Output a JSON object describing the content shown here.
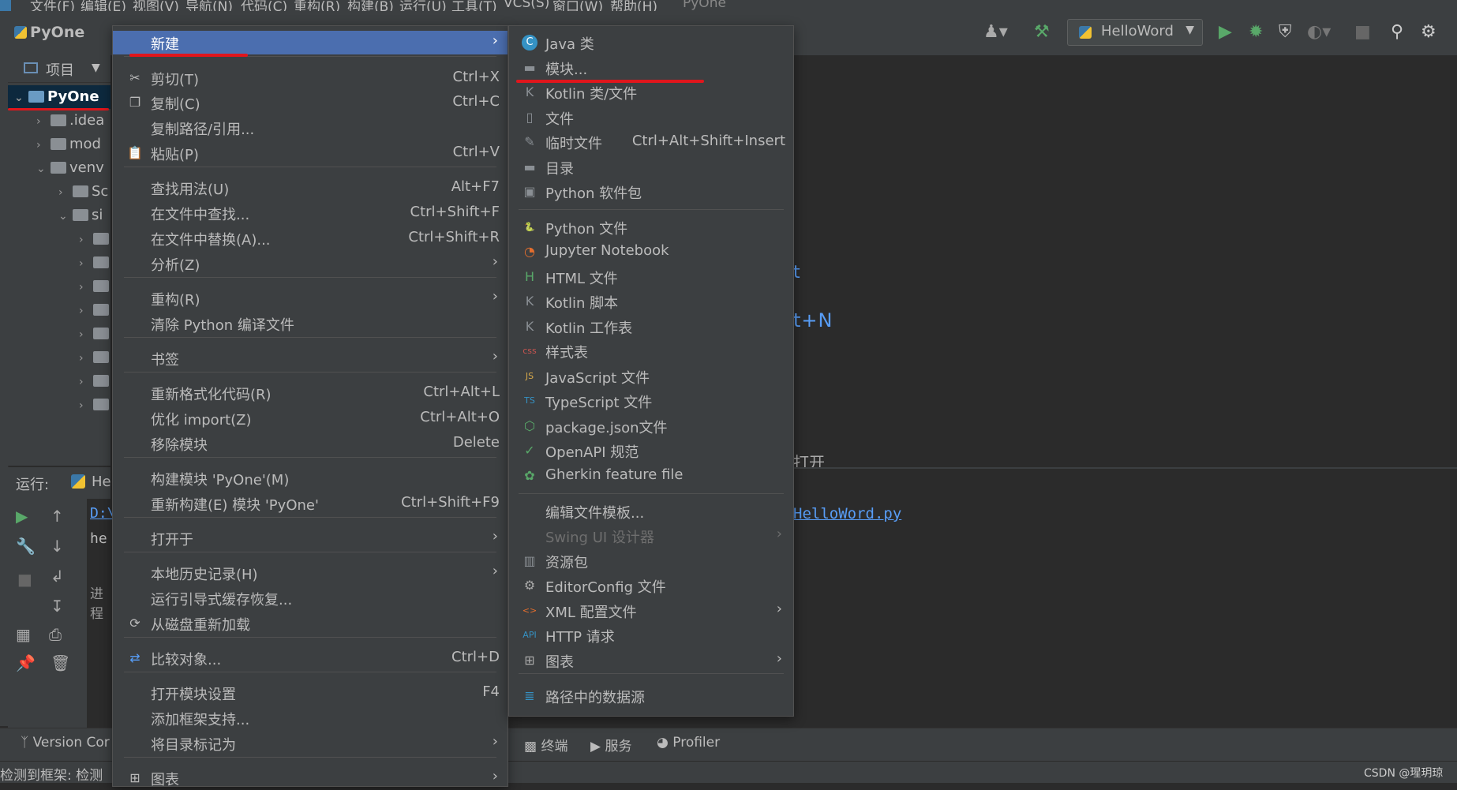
{
  "menubar": {
    "items": [
      "文件(F)",
      "编辑(E)",
      "视图(V)",
      "导航(N)",
      "代码(C)",
      "重构(R)",
      "构建(B)",
      "运行(U)",
      "工具(T)",
      "VCS(S)",
      "窗口(W)",
      "帮助(H)"
    ],
    "app_title": "PyOne"
  },
  "toolbar": {
    "project_name": "PyOne",
    "run_config": "HelloWord"
  },
  "project_panel": {
    "header": "项目",
    "root": "PyOne",
    "nodes": [
      ".idea",
      "mod",
      "venv",
      "Sc",
      "si"
    ]
  },
  "run_panel": {
    "header_label": "运行:",
    "tab": "He",
    "line1": "D:\\",
    "line2": "he",
    "line3": "进程",
    "path_tail": "HelloWord.py"
  },
  "editor": {
    "hint1": "t",
    "hint2": "t+N",
    "hint3": "打开"
  },
  "context_menu": {
    "items": [
      {
        "label": "新建",
        "shortcut": "",
        "submenu": true,
        "icon": ""
      },
      {
        "label": "剪切(T)",
        "shortcut": "Ctrl+X",
        "icon": "scissors-icon"
      },
      {
        "label": "复制(C)",
        "shortcut": "Ctrl+C",
        "icon": "copy-icon"
      },
      {
        "label": "复制路径/引用...",
        "shortcut": ""
      },
      {
        "label": "粘贴(P)",
        "shortcut": "Ctrl+V",
        "icon": "paste-icon"
      },
      {
        "label": "查找用法(U)",
        "shortcut": "Alt+F7"
      },
      {
        "label": "在文件中查找...",
        "shortcut": "Ctrl+Shift+F"
      },
      {
        "label": "在文件中替换(A)...",
        "shortcut": "Ctrl+Shift+R"
      },
      {
        "label": "分析(Z)",
        "shortcut": "",
        "submenu": true
      },
      {
        "label": "重构(R)",
        "shortcut": "",
        "submenu": true
      },
      {
        "label": "清除 Python 编译文件",
        "shortcut": ""
      },
      {
        "label": "书签",
        "shortcut": "",
        "submenu": true
      },
      {
        "label": "重新格式化代码(R)",
        "shortcut": "Ctrl+Alt+L"
      },
      {
        "label": "优化 import(Z)",
        "shortcut": "Ctrl+Alt+O"
      },
      {
        "label": "移除模块",
        "shortcut": "Delete"
      },
      {
        "label": "构建模块 'PyOne'(M)",
        "shortcut": ""
      },
      {
        "label": "重新构建(E) 模块 'PyOne'",
        "shortcut": "Ctrl+Shift+F9"
      },
      {
        "label": "打开于",
        "shortcut": "",
        "submenu": true
      },
      {
        "label": "本地历史记录(H)",
        "shortcut": "",
        "submenu": true
      },
      {
        "label": "运行引导式缓存恢复...",
        "shortcut": ""
      },
      {
        "label": "从磁盘重新加载",
        "shortcut": "",
        "icon": "reload-icon"
      },
      {
        "label": "比较对象...",
        "shortcut": "Ctrl+D",
        "icon": "compare-icon"
      },
      {
        "label": "打开模块设置",
        "shortcut": "F4"
      },
      {
        "label": "添加框架支持...",
        "shortcut": ""
      },
      {
        "label": "将目录标记为",
        "shortcut": "",
        "submenu": true
      },
      {
        "label": "图表",
        "shortcut": "",
        "submenu": true,
        "icon": "diagram-icon"
      }
    ]
  },
  "new_submenu": {
    "items": [
      {
        "label": "Java 类",
        "shortcut": "",
        "icon": "java-class-icon"
      },
      {
        "label": "模块...",
        "shortcut": "",
        "icon": "module-icon"
      },
      {
        "label": "Kotlin 类/文件",
        "shortcut": "",
        "icon": "kotlin-file-icon"
      },
      {
        "label": "文件",
        "shortcut": "",
        "icon": "file-icon"
      },
      {
        "label": "临时文件",
        "shortcut": "Ctrl+Alt+Shift+Insert",
        "icon": "scratch-file-icon"
      },
      {
        "label": "目录",
        "shortcut": "",
        "icon": "folder-icon"
      },
      {
        "label": "Python 软件包",
        "shortcut": "",
        "icon": "python-package-icon"
      },
      {
        "label": "Python 文件",
        "shortcut": "",
        "icon": "python-file-icon"
      },
      {
        "label": "Jupyter Notebook",
        "shortcut": "",
        "icon": "jupyter-icon"
      },
      {
        "label": "HTML 文件",
        "shortcut": "",
        "icon": "html-file-icon"
      },
      {
        "label": "Kotlin 脚本",
        "shortcut": "",
        "icon": "kotlin-script-icon"
      },
      {
        "label": "Kotlin 工作表",
        "shortcut": "",
        "icon": "kotlin-worksheet-icon"
      },
      {
        "label": "样式表",
        "shortcut": "",
        "icon": "css-icon"
      },
      {
        "label": "JavaScript 文件",
        "shortcut": "",
        "icon": "javascript-icon"
      },
      {
        "label": "TypeScript 文件",
        "shortcut": "",
        "icon": "typescript-icon"
      },
      {
        "label": "package.json文件",
        "shortcut": "",
        "icon": "package-json-icon"
      },
      {
        "label": "OpenAPI 规范",
        "shortcut": "",
        "icon": "openapi-icon"
      },
      {
        "label": "Gherkin feature file",
        "shortcut": "",
        "icon": "gherkin-icon"
      },
      {
        "label": "编辑文件模板...",
        "shortcut": ""
      },
      {
        "label": "Swing UI 设计器",
        "shortcut": "",
        "submenu": true,
        "disabled": true
      },
      {
        "label": "资源包",
        "shortcut": "",
        "icon": "resource-bundle-icon"
      },
      {
        "label": "EditorConfig 文件",
        "shortcut": "",
        "icon": "gear-icon"
      },
      {
        "label": "XML 配置文件",
        "shortcut": "",
        "submenu": true,
        "icon": "xml-icon"
      },
      {
        "label": "HTTP 请求",
        "shortcut": "",
        "icon": "http-api-icon"
      },
      {
        "label": "图表",
        "shortcut": "",
        "submenu": true,
        "icon": "diagram-icon"
      },
      {
        "label": "路径中的数据源",
        "shortcut": "",
        "icon": "database-icon"
      }
    ]
  },
  "bottom_tabs": {
    "version_control": "Version Cor",
    "terminal": "终端",
    "services": "服务",
    "profiler": "Profiler"
  },
  "status": {
    "message": "检测到框架: 检测",
    "watermark": "CSDN @瑆玥琼"
  },
  "colors": {
    "menu_bg": "#3c3f41",
    "selection": "#4b6eaf",
    "annotation_red": "#e0161c",
    "link_blue": "#589df6"
  }
}
